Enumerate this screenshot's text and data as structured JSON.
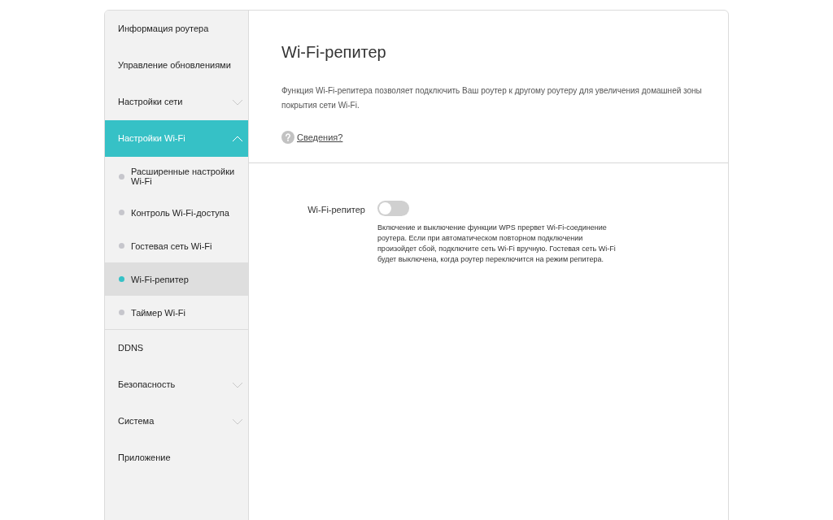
{
  "sidebar": {
    "items": [
      {
        "kind": "link",
        "label": "Информация роутера"
      },
      {
        "kind": "link",
        "label": "Управление обновлениями"
      },
      {
        "kind": "group",
        "label": "Настройки сети",
        "expanded": false
      },
      {
        "kind": "group",
        "label": "Настройки Wi-Fi",
        "expanded": true,
        "children": [
          {
            "label": "Расширенные настройки Wi-Fi",
            "selected": false
          },
          {
            "label": "Контроль Wi-Fi-доступа",
            "selected": false
          },
          {
            "label": "Гостевая сеть Wi-Fi",
            "selected": false
          },
          {
            "label": "Wi-Fi-репитер",
            "selected": true
          },
          {
            "label": "Таймер Wi-Fi",
            "selected": false
          }
        ]
      },
      {
        "kind": "link",
        "label": "DDNS"
      },
      {
        "kind": "group",
        "label": "Безопасность",
        "expanded": false
      },
      {
        "kind": "group",
        "label": "Система",
        "expanded": false
      },
      {
        "kind": "link",
        "label": "Приложение"
      }
    ]
  },
  "header": {
    "title": "Wi-Fi-репитер",
    "description": "Функция Wi-Fi-репитера позволяет подключить Ваш роутер к другому роутеру для увеличения домашней зоны покрытия сети Wi-Fi.",
    "help_link": "Сведения?"
  },
  "setting": {
    "label": "Wi-Fi-репитер",
    "on": false,
    "note": "Включение и выключение функции WPS прервет Wi-Fi-соединение роутера. Если при автоматическом повторном подключении произойдет сбой, подключите сеть Wi-Fi вручную. Гостевая сеть Wi-Fi будет выключена, когда роутер переключится на режим репитера."
  }
}
